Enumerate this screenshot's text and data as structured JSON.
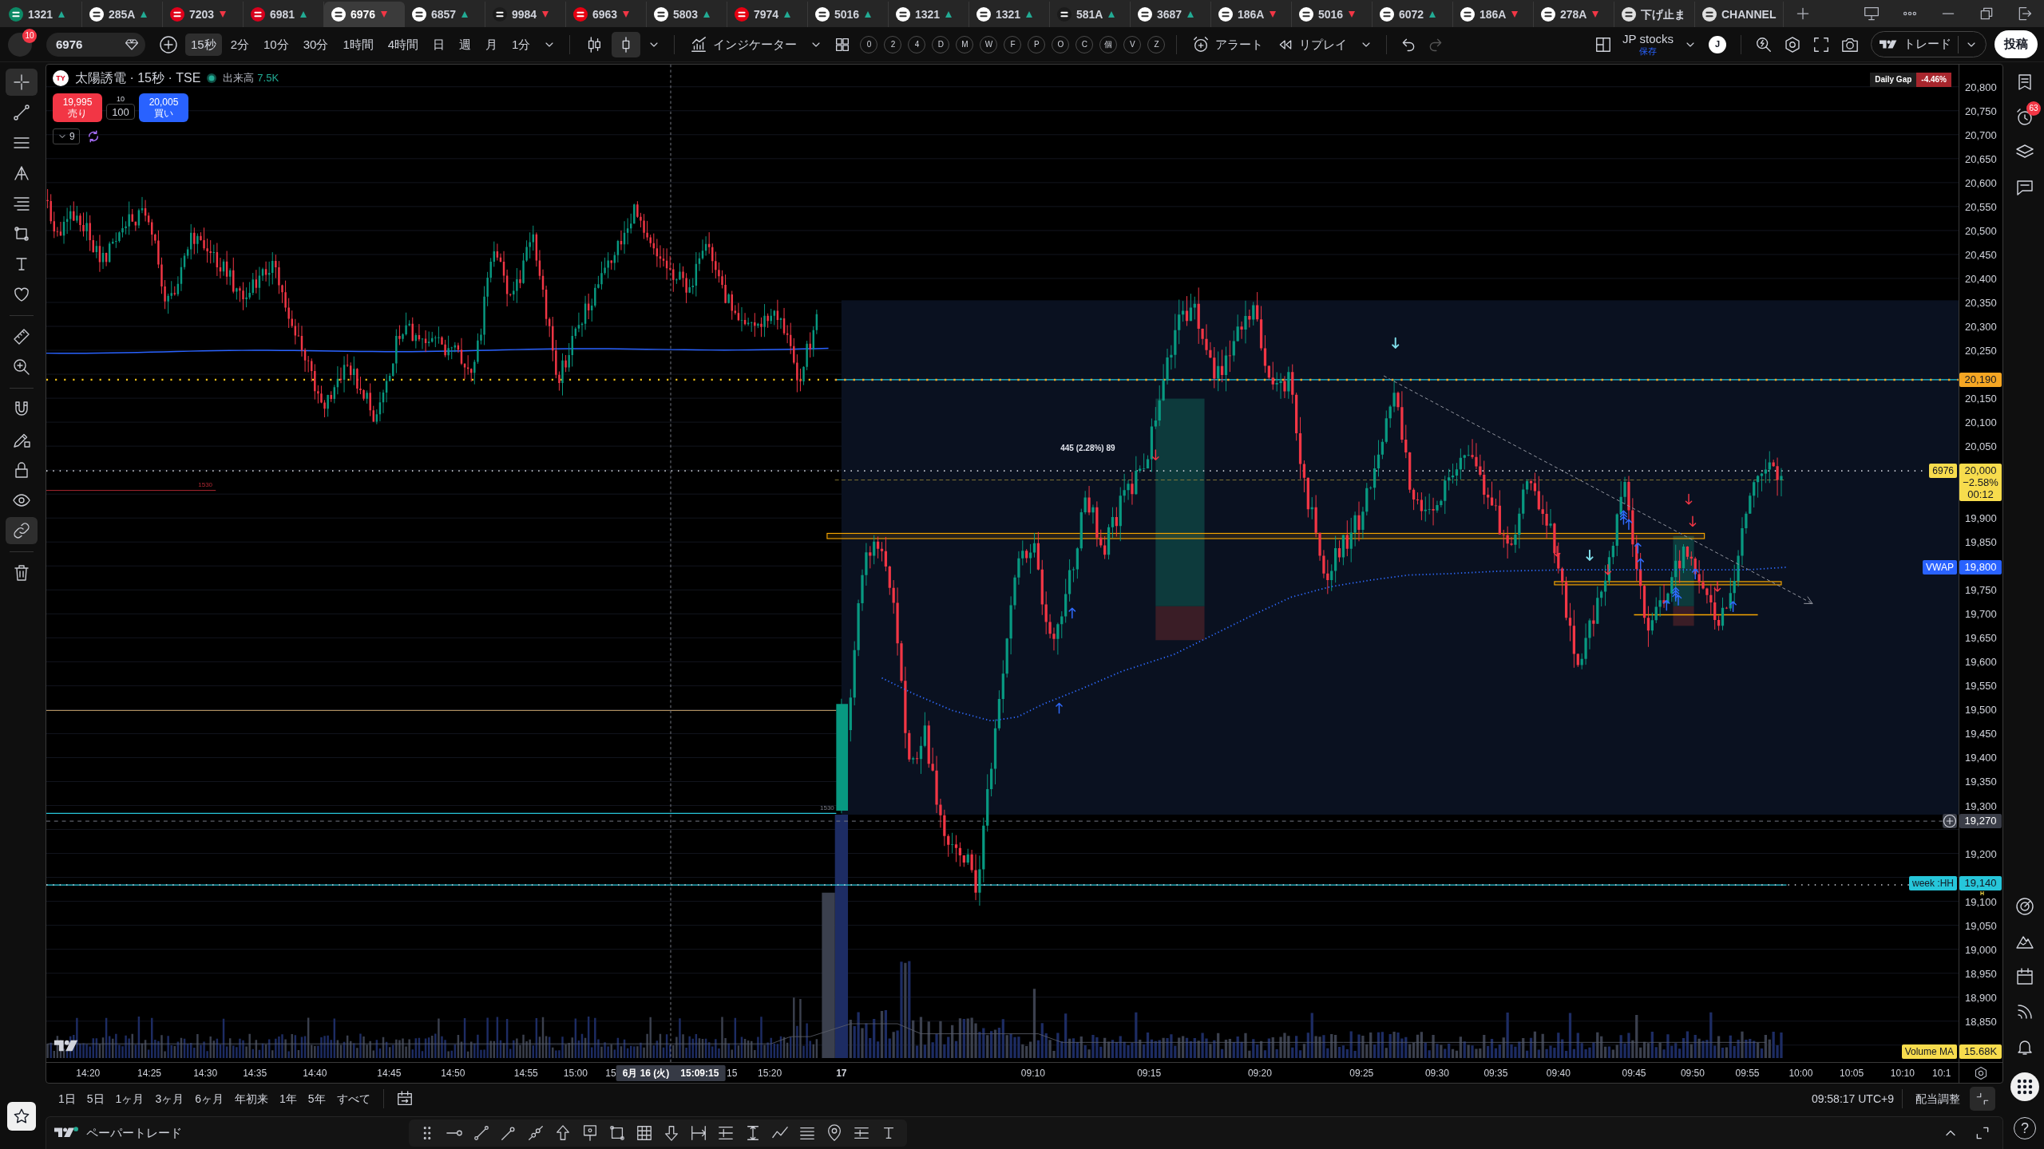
{
  "tabs": [
    {
      "symbol": "1321",
      "kind": "rising",
      "color": "#0d8a66",
      "selected": false
    },
    {
      "symbol": "285A",
      "kind": "rising",
      "color": "#ffffff",
      "selected": false
    },
    {
      "symbol": "7203",
      "kind": "falling",
      "color": "#e0001b",
      "selected": false
    },
    {
      "symbol": "6981",
      "kind": "rising",
      "color": "#d7001d",
      "selected": false
    },
    {
      "symbol": "6976",
      "kind": "falling",
      "color": "#ffffff",
      "selected": true
    },
    {
      "symbol": "6857",
      "kind": "rising",
      "color": "#ffffff",
      "selected": false
    },
    {
      "symbol": "9984",
      "kind": "falling",
      "color": "#1b1b1b",
      "selected": false
    },
    {
      "symbol": "6963",
      "kind": "falling",
      "color": "#e60012",
      "selected": false
    },
    {
      "symbol": "5803",
      "kind": "rising",
      "color": "#ffffff",
      "selected": false
    },
    {
      "symbol": "7974",
      "kind": "rising",
      "color": "#e60012",
      "selected": false
    },
    {
      "symbol": "5016",
      "kind": "rising",
      "color": "#ffffff",
      "selected": false
    },
    {
      "symbol": "1321",
      "kind": "rising",
      "color": "#ffffff",
      "selected": false
    },
    {
      "symbol": "1321",
      "kind": "rising",
      "color": "#ffffff",
      "selected": false
    },
    {
      "symbol": "581A",
      "kind": "rising",
      "color": "#1b1b1b",
      "selected": false
    },
    {
      "symbol": "3687",
      "kind": "rising",
      "color": "#ffffff",
      "selected": false
    },
    {
      "symbol": "186A",
      "kind": "falling",
      "color": "#ffffff",
      "selected": false
    },
    {
      "symbol": "5016",
      "kind": "falling",
      "color": "#ffffff",
      "selected": false
    },
    {
      "symbol": "6072",
      "kind": "rising",
      "color": "#ffffff",
      "selected": false
    },
    {
      "symbol": "186A",
      "kind": "falling",
      "color": "#ffffff",
      "selected": false
    },
    {
      "symbol": "278A",
      "kind": "falling",
      "color": "#ffffff",
      "selected": false
    },
    {
      "symbol": "下げ止ま",
      "kind": "plain",
      "color": "#e0e0e0",
      "selected": false
    },
    {
      "symbol": "CHANNEL",
      "kind": "plain",
      "color": "#e0e0e0",
      "selected": false
    }
  ],
  "toolbar": {
    "notifications": "10",
    "symbol": "6976",
    "intervals": [
      {
        "label": "15秒",
        "selected": true
      },
      {
        "label": "2分",
        "selected": false
      },
      {
        "label": "10分",
        "selected": false
      },
      {
        "label": "30分",
        "selected": false
      },
      {
        "label": "1時間",
        "selected": false
      },
      {
        "label": "4時間",
        "selected": false
      },
      {
        "label": "日",
        "selected": false
      },
      {
        "label": "週",
        "selected": false
      },
      {
        "label": "月",
        "selected": false
      },
      {
        "label": "1分",
        "selected": false
      }
    ],
    "chart_styles": [
      {
        "selected": false
      },
      {
        "selected": true
      }
    ],
    "indicators": "インジケーター",
    "quick_keys": [
      "0",
      "2",
      "4",
      "D",
      "M",
      "W",
      "F",
      "P",
      "O",
      "C",
      "個",
      "V",
      "Z"
    ],
    "alert": "アラート",
    "replay": "リプレイ",
    "undo": {
      "disabled": false
    },
    "redo": {
      "disabled": true
    },
    "layout_name": "JP stocks",
    "save_status": "保存",
    "user_initial": "J",
    "trade": "トレード",
    "publish": "投稿"
  },
  "drawing_tools": [
    {
      "selected": true
    },
    {
      "selected": false
    },
    {
      "selected": false
    },
    {
      "selected": false
    },
    {
      "selected": false
    },
    {
      "selected": false
    },
    {
      "selected": false
    },
    {
      "selected": false
    },
    {
      "selected": false
    },
    {
      "selected": false
    },
    {
      "selected": false
    },
    {
      "selected": false
    },
    {
      "selected": false
    },
    {
      "selected": false
    },
    {
      "selected": true
    },
    {
      "selected": false
    }
  ],
  "chart": {
    "legend": {
      "logo": "TY",
      "title": "太陽誘電 · 15秒 · TSE",
      "volume_label": "出来高",
      "volume_value": "7.5K"
    },
    "order": {
      "sell_price": "19,995",
      "sell_label": "売り",
      "lot": "10",
      "quantity": "100",
      "buy_price": "20,005",
      "buy_label": "買い"
    },
    "collapsed_count": "9",
    "daily_gap": {
      "label": "Daily Gap",
      "value": "-4.46%"
    },
    "annotations": [
      {
        "kind": "measure",
        "text": "445 (2.28%) 89"
      },
      {
        "kind": "level-red",
        "text": "1530"
      },
      {
        "kind": "level-grey",
        "text": "1530"
      }
    ],
    "price_axis": [
      "20,800",
      "20,750",
      "20,700",
      "20,650",
      "20,600",
      "20,550",
      "20,500",
      "20,450",
      "20,400",
      "20,350",
      "20,300",
      "20,250",
      "20,150",
      "20,100",
      "20,050",
      "19,900",
      "19,850",
      "19,750",
      "19,700",
      "19,650",
      "19,600",
      "19,550",
      "19,500",
      "19,450",
      "19,400",
      "19,350",
      "19,300",
      "19,200",
      "19,100",
      "19,050",
      "19,000",
      "18,950",
      "18,900",
      "18,850"
    ],
    "price_badges": [
      {
        "kind": "alert-level",
        "value": "20,190"
      },
      {
        "kind": "last-price",
        "tag": "6976",
        "value": "20,000",
        "change": "−2.58%",
        "countdown": "00:12"
      },
      {
        "kind": "vwap",
        "tag": "VWAP",
        "value": "19,800"
      },
      {
        "kind": "crosshair",
        "value": "19,270"
      },
      {
        "kind": "week-high",
        "tag": "week :HH",
        "value": "19,140",
        "marker": "H"
      },
      {
        "kind": "volume-ma",
        "tag": "Volume MA",
        "value": "15.68K"
      }
    ],
    "time_axis": [
      {
        "text": "14:20",
        "kind": "time"
      },
      {
        "text": "14:25",
        "kind": "time"
      },
      {
        "text": "14:30",
        "kind": "time"
      },
      {
        "text": "14:35",
        "kind": "time"
      },
      {
        "text": "14:40",
        "kind": "time"
      },
      {
        "text": "14:45",
        "kind": "time"
      },
      {
        "text": "14:50",
        "kind": "time"
      },
      {
        "text": "14:55",
        "kind": "time"
      },
      {
        "text": "15:00",
        "kind": "time"
      },
      {
        "text": "15",
        "kind": "time"
      },
      {
        "text": "15",
        "kind": "time"
      },
      {
        "text": "15:20",
        "kind": "time"
      },
      {
        "text": "17",
        "kind": "day"
      },
      {
        "text": "09:10",
        "kind": "time"
      },
      {
        "text": "09:15",
        "kind": "time"
      },
      {
        "text": "09:20",
        "kind": "time"
      },
      {
        "text": "09:25",
        "kind": "time"
      },
      {
        "text": "09:30",
        "kind": "time"
      },
      {
        "text": "09:35",
        "kind": "time"
      },
      {
        "text": "09:40",
        "kind": "time"
      },
      {
        "text": "09:45",
        "kind": "time"
      },
      {
        "text": "09:50",
        "kind": "time"
      },
      {
        "text": "09:55",
        "kind": "time"
      },
      {
        "text": "10:00",
        "kind": "time"
      },
      {
        "text": "10:05",
        "kind": "time"
      },
      {
        "text": "10:10",
        "kind": "time"
      },
      {
        "text": "10:1",
        "kind": "time"
      }
    ],
    "crosshair": {
      "date": "6月 16 (火)",
      "time": "15:09:15"
    }
  },
  "range_bar": {
    "ranges": [
      "1日",
      "5日",
      "1ヶ月",
      "3ヶ月",
      "6ヶ月",
      "年初来",
      "1年",
      "5年",
      "すべて"
    ],
    "clock": "09:58:17 UTC+9",
    "adjust": "配当調整"
  },
  "bottom_panel": {
    "title": "ペーパートレード"
  },
  "sidebar": {
    "alerts_badge": "63",
    "help": "?"
  }
}
